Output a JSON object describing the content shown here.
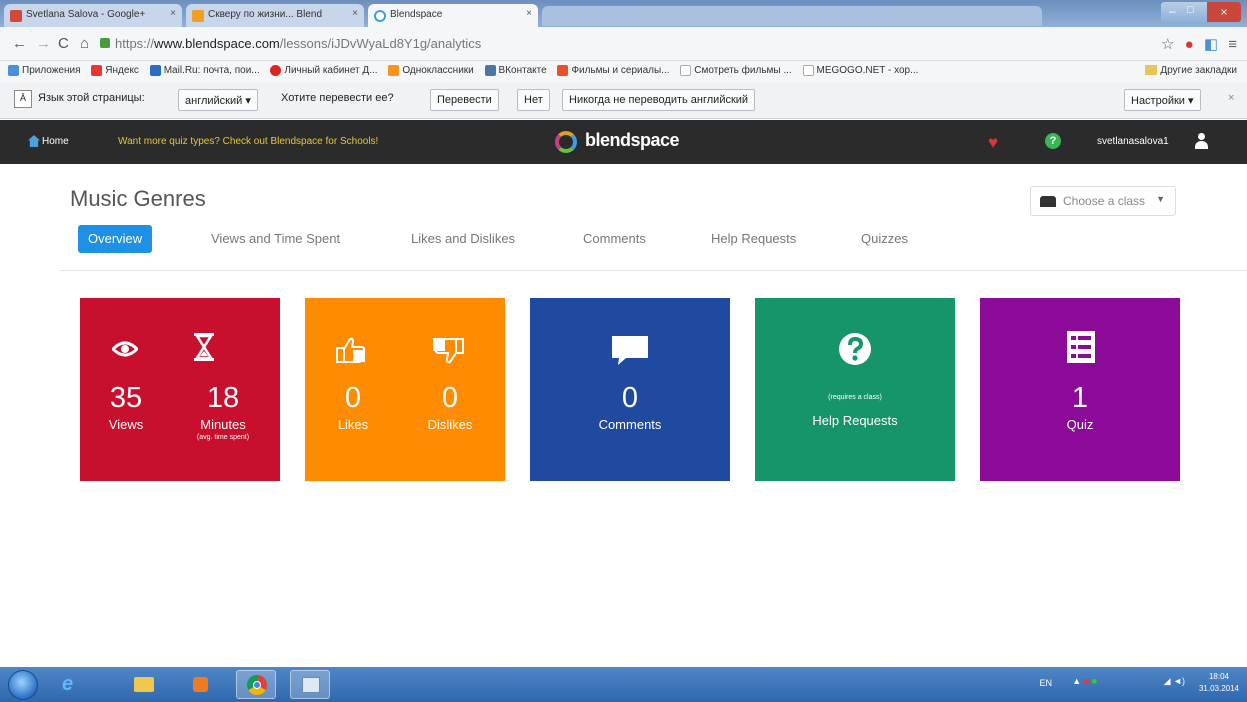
{
  "browser": {
    "tabs": [
      {
        "title": "Svetlana Salova - Google+",
        "active": false
      },
      {
        "title": "Скверу по жизни... Blend",
        "active": false
      },
      {
        "title": "Blendspace",
        "active": true
      }
    ],
    "url_scheme": "https://",
    "url_host": "www.blendspace.com",
    "url_path": "/lessons/iJDvWyaLd8Y1g/analytics",
    "bookmarks": [
      "Приложения",
      "Яндекс",
      "Mail.Ru: почта, пои...",
      "Личный кабинет Д...",
      "Одноклассники",
      "ВКонтакте",
      "Фильмы и сериалы...",
      "Смотреть фильмы ...",
      "MEGOGO.NET - хор..."
    ],
    "bookmarks_other": "Другие закладки"
  },
  "translate_bar": {
    "page_language_label": "Язык этой страницы:",
    "language_value": "английский",
    "question": "Хотите перевести ее?",
    "translate_button": "Перевести",
    "no_button": "Нет",
    "never_button": "Никогда не переводить английский",
    "settings_button": "Настройки"
  },
  "site_nav": {
    "home": "Home",
    "promo": "Want more quiz types? Check out Blendspace for Schools!",
    "brand": "blendspace",
    "username": "svetlanasalova1"
  },
  "page": {
    "title": "Music Genres",
    "class_select_placeholder": "Choose a class",
    "tabs": [
      "Overview",
      "Views and Time Spent",
      "Likes and Dislikes",
      "Comments",
      "Help Requests",
      "Quizzes"
    ],
    "active_tab": "Overview"
  },
  "cards": {
    "views": {
      "value": "35",
      "label": "Views",
      "color": "#c8102e"
    },
    "minutes": {
      "value": "18",
      "label": "Minutes",
      "sub": "(avg. time spent)"
    },
    "likes": {
      "value": "0",
      "label": "Likes",
      "color": "#ff8c00"
    },
    "dislikes": {
      "value": "0",
      "label": "Dislikes"
    },
    "comments": {
      "value": "0",
      "label": "Comments",
      "color": "#1f4aa0"
    },
    "help": {
      "note": "(requires a class)",
      "label": "Help Requests",
      "color": "#17956a"
    },
    "quiz": {
      "value": "1",
      "label": "Quiz",
      "color": "#8b0a98"
    }
  },
  "taskbar": {
    "lang": "EN",
    "time": "18:04",
    "date": "31.03.2014"
  }
}
